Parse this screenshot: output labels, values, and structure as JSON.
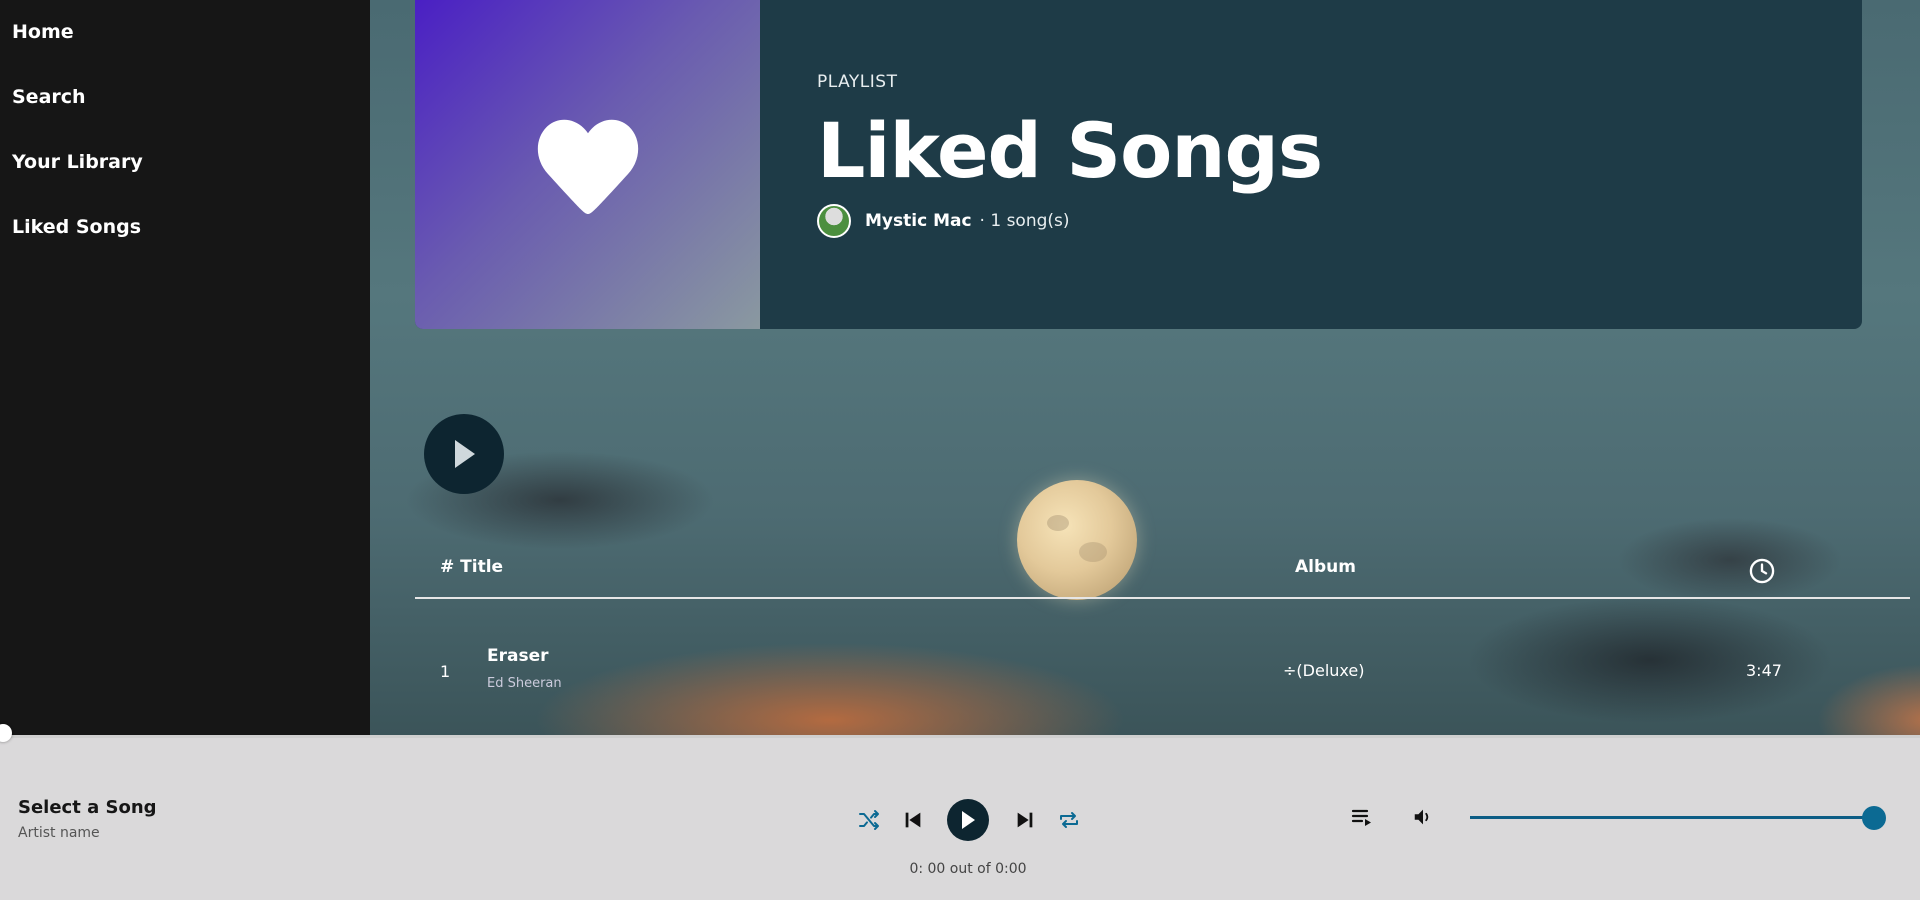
{
  "sidebar": {
    "items": [
      {
        "label": "Home"
      },
      {
        "label": "Search"
      },
      {
        "label": "Your Library"
      },
      {
        "label": "Liked Songs"
      }
    ]
  },
  "playlist": {
    "tag": "PLAYLIST",
    "title": "Liked Songs",
    "owner": "Mystic Mac",
    "song_count": "· 1 song(s)"
  },
  "table": {
    "header_title": "# Title",
    "header_album": "Album",
    "rows": [
      {
        "number": "1",
        "title": "Eraser",
        "artist": "Ed Sheeran",
        "album": "÷(Deluxe)",
        "duration": "3:47"
      }
    ]
  },
  "player": {
    "song_title": "Select a Song",
    "artist": "Artist name",
    "time_text": "0: 00 out of 0:00",
    "progress": 0,
    "volume": 1.0,
    "accent_color": "#0c6a93"
  }
}
